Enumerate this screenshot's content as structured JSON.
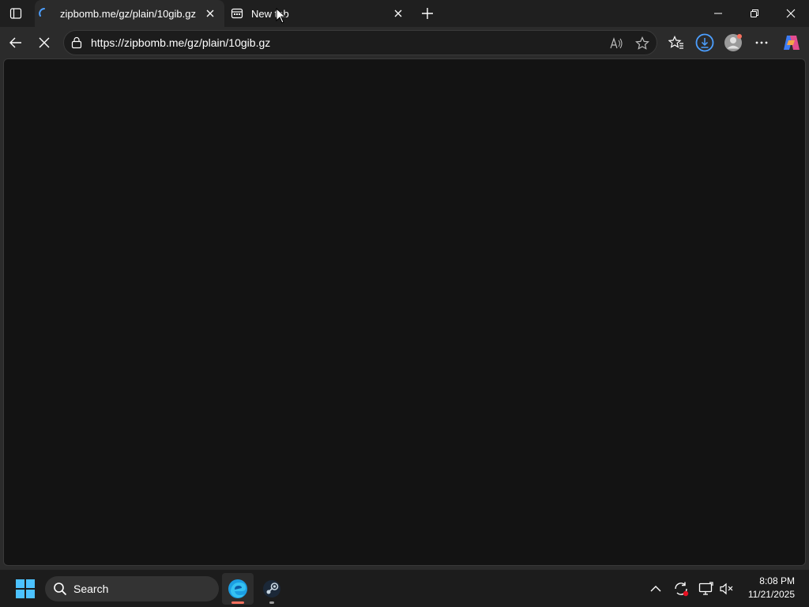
{
  "browser": {
    "tabs": [
      {
        "title": "zipbomb.me/gz/plain/10gib.gz",
        "active": true
      },
      {
        "title": "New tab",
        "active": false
      }
    ],
    "address": {
      "url": "https://zipbomb.me/gz/plain/10gib.gz"
    }
  },
  "taskbar": {
    "search_label": "Search",
    "clock": {
      "time": "8:08 PM",
      "date": "11/21/2025"
    }
  },
  "colors": {
    "accent": "#0078d4",
    "download_ring": "#4c9fff",
    "edge_indicator": "#f7705e",
    "content_bg": "#131313"
  },
  "icons": [
    "tab-actions-icon",
    "page-loading-icon",
    "close-icon",
    "new-tab-icon",
    "minimize-icon",
    "restore-icon",
    "back-arrow-icon",
    "stop-loading-icon",
    "lock-icon",
    "read-aloud-icon",
    "star-icon",
    "favorites-icon",
    "download-icon",
    "profile-icon",
    "more-icon",
    "copilot-icon",
    "windows-start-icon",
    "search-icon",
    "edge-icon",
    "steam-icon",
    "chevron-up-icon",
    "sync-icon",
    "display-icon",
    "volume-muted-icon"
  ]
}
